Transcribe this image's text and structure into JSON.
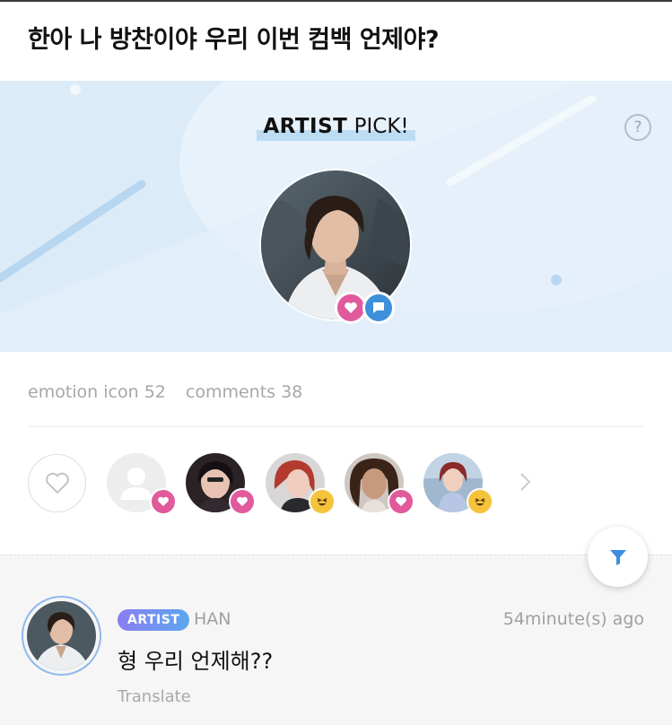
{
  "post": {
    "title": "한아 나 방찬이야 우리 이번 컴백 언제야?"
  },
  "artist_pick": {
    "title_bold": "ARTIST",
    "title_rest": " PICK!",
    "help_symbol": "?",
    "badges": [
      "heart-icon",
      "comment-icon"
    ]
  },
  "stats": {
    "emotion_label": "emotion icon 52",
    "comments_label": "comments 38"
  },
  "reactions": {
    "reactors": [
      {
        "emotion": "heart"
      },
      {
        "emotion": "heart"
      },
      {
        "emotion": "laugh"
      },
      {
        "emotion": "heart"
      },
      {
        "emotion": "laugh"
      }
    ]
  },
  "comment": {
    "tag": "ARTIST",
    "author": "HAN",
    "time": "54minute(s) ago",
    "text": "형 우리 언제해??",
    "translate": "Translate"
  },
  "colors": {
    "banner_bg": "#dcebf8",
    "heart_pink": "#e05a9c",
    "comment_blue": "#3d90d9",
    "laugh_yellow": "#f5c33b",
    "filter_blue": "#3d8fe0"
  }
}
